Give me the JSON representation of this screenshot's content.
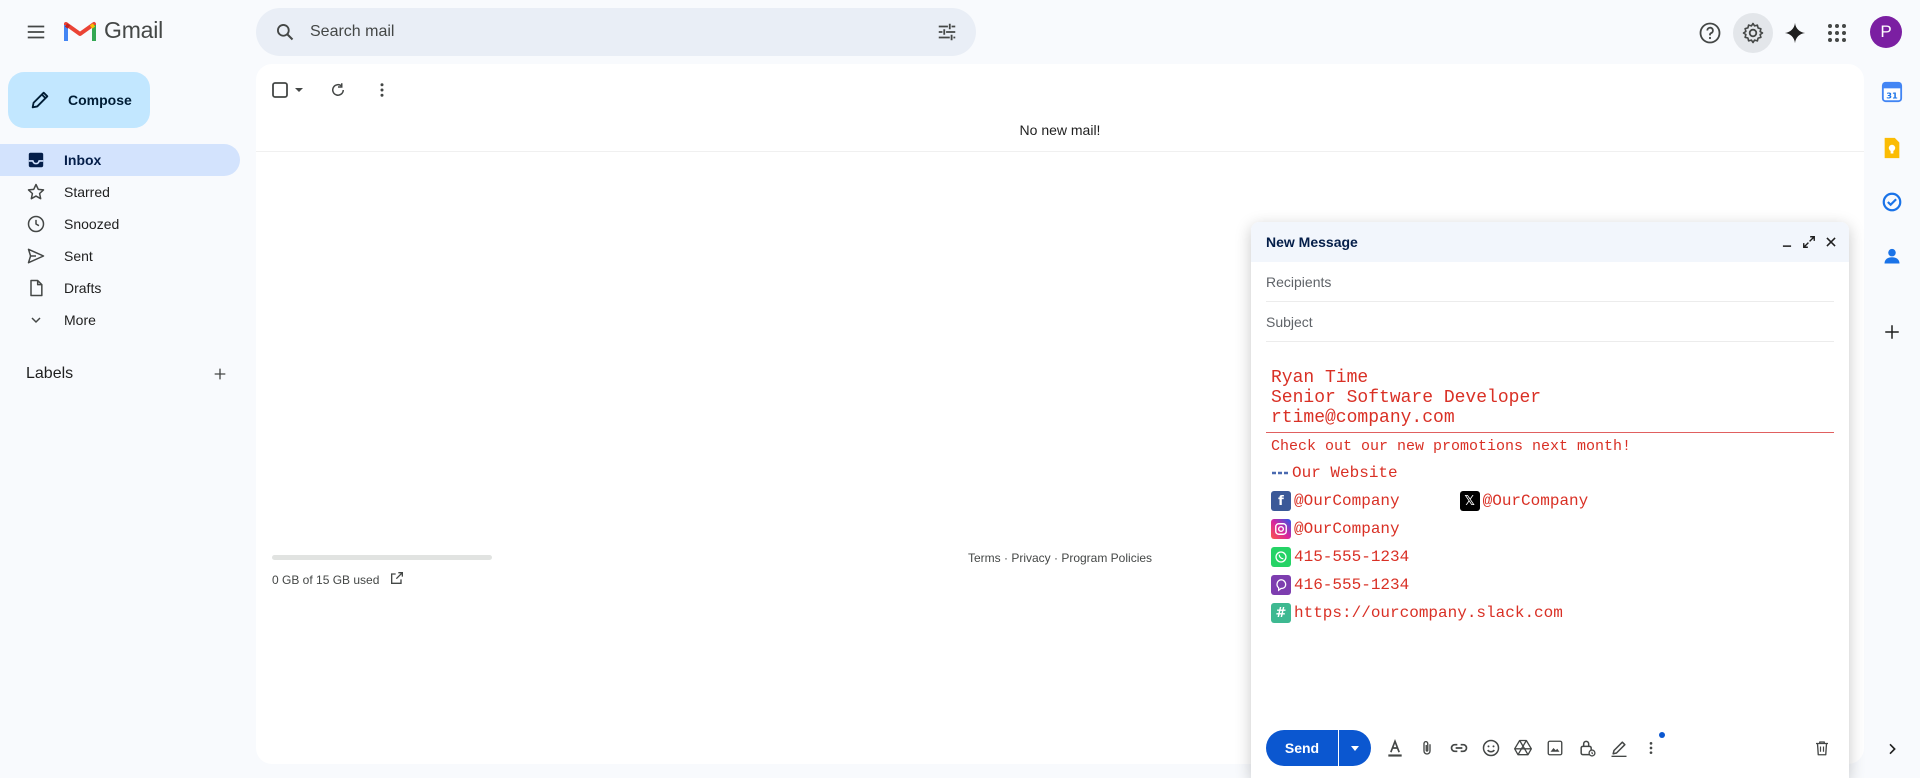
{
  "header": {
    "app_name": "Gmail",
    "search_placeholder": "Search mail",
    "avatar_letter": "P"
  },
  "nav": {
    "compose_label": "Compose",
    "items": [
      {
        "label": "Inbox",
        "icon": "inbox-icon",
        "active": true
      },
      {
        "label": "Starred",
        "icon": "star-icon"
      },
      {
        "label": "Snoozed",
        "icon": "clock-icon"
      },
      {
        "label": "Sent",
        "icon": "send-icon"
      },
      {
        "label": "Drafts",
        "icon": "draft-icon"
      },
      {
        "label": "More",
        "icon": "chevron-down-icon"
      }
    ],
    "labels_title": "Labels"
  },
  "main": {
    "empty_message": "No new mail!",
    "storage_text": "0 GB of 15 GB used",
    "storage_used_fraction": 0,
    "footer_links": "Terms · Privacy · Program Policies"
  },
  "composer": {
    "title": "New Message",
    "recipients_placeholder": "Recipients",
    "subject_placeholder": "Subject",
    "signature": {
      "name": "Ryan Time",
      "role": "Senior Software Developer",
      "email": "rtime@company.com",
      "promo": "Check out our new promotions next month!",
      "website": "Our Website",
      "facebook": "@OurCompany",
      "twitter": "@OurCompany",
      "instagram": "@OurCompany",
      "whatsapp": "415-555-1234",
      "viber": "416-555-1234",
      "slack": "https://ourcompany.slack.com"
    },
    "send_label": "Send"
  },
  "colors": {
    "accent": "#0b57d0",
    "signature_red": "#d93025",
    "compose_bg": "#c2e7ff",
    "nav_active": "#d3e3fd"
  }
}
